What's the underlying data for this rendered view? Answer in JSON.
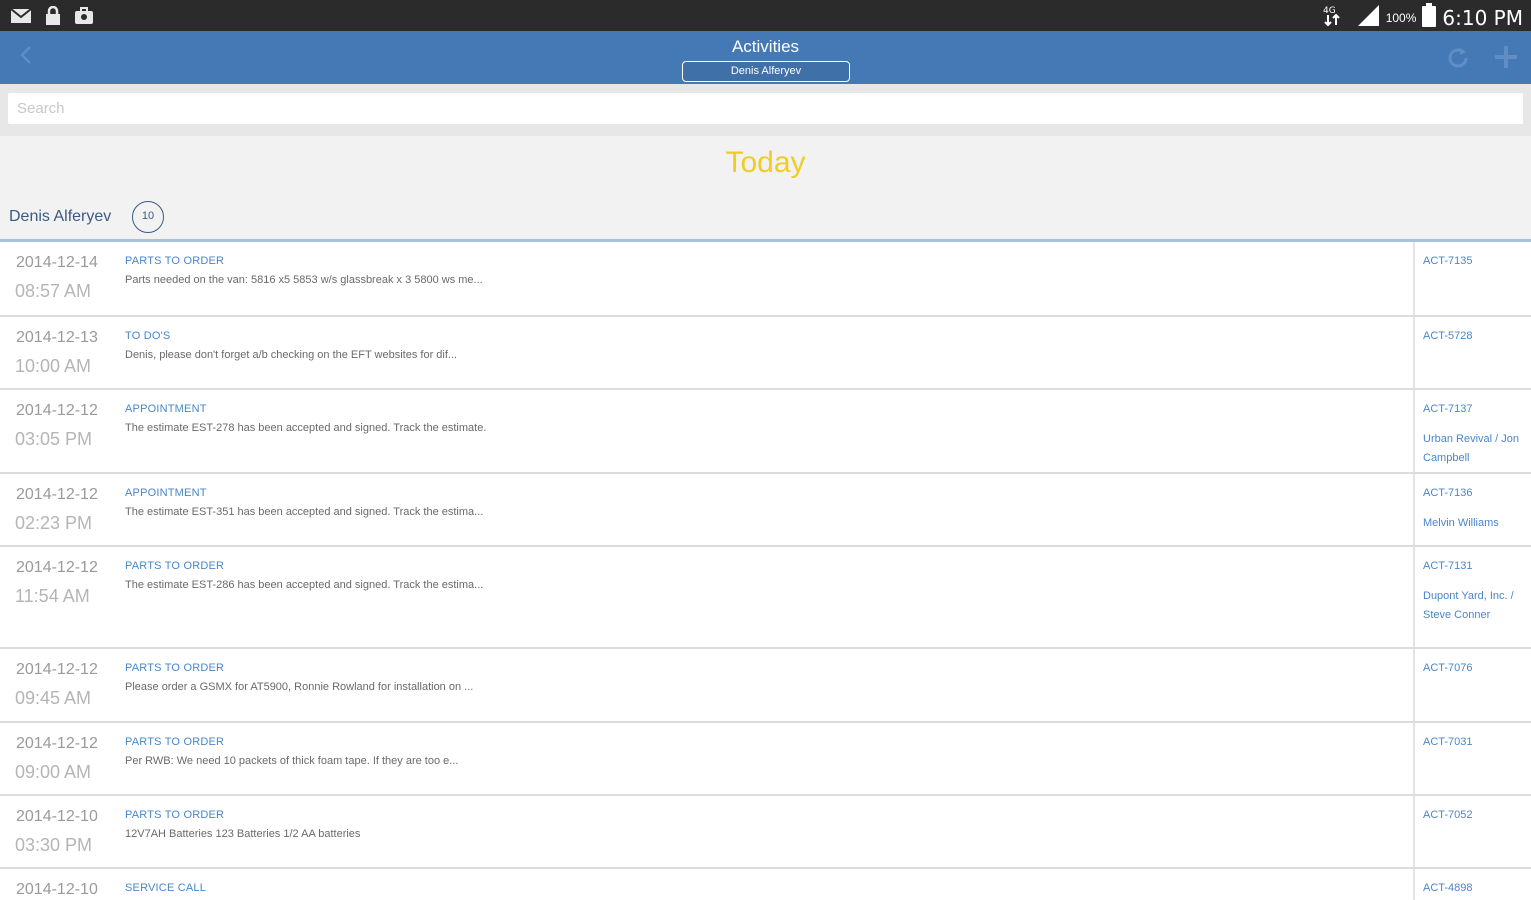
{
  "status_bar": {
    "time": "6:10 PM",
    "battery": "100%",
    "left_icons": [
      "mail-icon",
      "lock-icon",
      "briefcase-icon"
    ],
    "right_icons": [
      "data-transfer-icon",
      "signal-icon",
      "battery-icon"
    ]
  },
  "action_bar": {
    "title": "Activities",
    "user_selector": "Denis Alferyev",
    "back_icon": "chevron-left-icon",
    "refresh_icon": "refresh-icon",
    "add_icon": "plus-icon",
    "color": "#4479b5"
  },
  "search": {
    "placeholder": "Search",
    "value": ""
  },
  "group": {
    "heading": "Today",
    "owner": "Denis Alferyev",
    "count": "10",
    "heading_color": "#f0cc25"
  },
  "activities": [
    {
      "date": "2014-12-14",
      "time": "08:57 AM",
      "type": "PARTS TO ORDER",
      "description": "Parts needed on the van: 5816 x5 5853 w/s glassbreak x 3 5800 ws me...",
      "ref": "ACT-7135",
      "client": ""
    },
    {
      "date": "2014-12-13",
      "time": "10:00 AM",
      "type": "TO DO'S",
      "description": "Denis, please don't forget a/b checking on the EFT websites for dif...",
      "ref": "ACT-5728",
      "client": ""
    },
    {
      "date": "2014-12-12",
      "time": "03:05 PM",
      "type": "APPOINTMENT",
      "description": "The estimate EST-278 has been accepted and signed. Track the estimate.",
      "ref": "ACT-7137",
      "client": "Urban Revival / Jon Campbell"
    },
    {
      "date": "2014-12-12",
      "time": "02:23 PM",
      "type": "APPOINTMENT",
      "description": "The estimate EST-351 has been accepted and signed. Track the estima...",
      "ref": "ACT-7136",
      "client": "Melvin Williams"
    },
    {
      "date": "2014-12-12",
      "time": "11:54 AM",
      "type": "PARTS TO ORDER",
      "description": "The estimate EST-286 has been accepted and signed. Track the estima...",
      "ref": "ACT-7131",
      "client": "Dupont Yard, Inc. / Steve Conner"
    },
    {
      "date": "2014-12-12",
      "time": "09:45 AM",
      "type": "PARTS TO ORDER",
      "description": "Please order a GSMX for AT5900, Ronnie Rowland for installation on ...",
      "ref": "ACT-7076",
      "client": ""
    },
    {
      "date": "2014-12-12",
      "time": "09:00 AM",
      "type": "PARTS TO ORDER",
      "description": "Per RWB: We need 10 packets of thick foam tape. If they are too e...",
      "ref": "ACT-7031",
      "client": ""
    },
    {
      "date": "2014-12-10",
      "time": "03:30 PM",
      "type": "PARTS TO ORDER",
      "description": "12V7AH Batteries 123 Batteries 1/2 AA batteries",
      "ref": "ACT-7052",
      "client": ""
    },
    {
      "date": "2014-12-10",
      "time": "",
      "type": "SERVICE CALL",
      "description": "",
      "ref": "ACT-4898",
      "client": ""
    }
  ]
}
